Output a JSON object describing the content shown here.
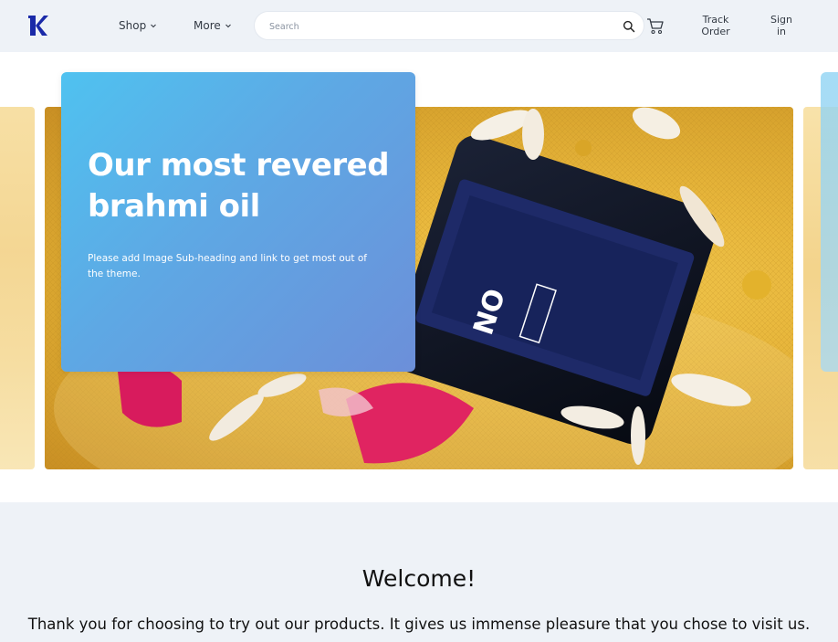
{
  "header": {
    "nav": [
      {
        "label": "Shop"
      },
      {
        "label": "More"
      }
    ],
    "search": {
      "placeholder": "Search"
    },
    "links": {
      "track_order": "Track Order",
      "sign_in": "Sign in"
    },
    "icons": {
      "logo": "brand-logo-k",
      "search": "search-icon",
      "cart": "cart-icon",
      "chevron": "chevron-down-icon"
    },
    "colors": {
      "logo": "#1a2aa8",
      "header_bg": "#eef2f7"
    }
  },
  "hero": {
    "title": "Our most revered brahmi oil",
    "subtitle": "Please add Image Sub-heading and link to get most out of the theme.",
    "colors": {
      "card_start": "#4fc2f0",
      "card_end": "#6c8fd9"
    }
  },
  "welcome": {
    "title": "Welcome!",
    "text": "Thank you for choosing to try out our products. It gives us immense pleasure that you chose to visit us."
  }
}
